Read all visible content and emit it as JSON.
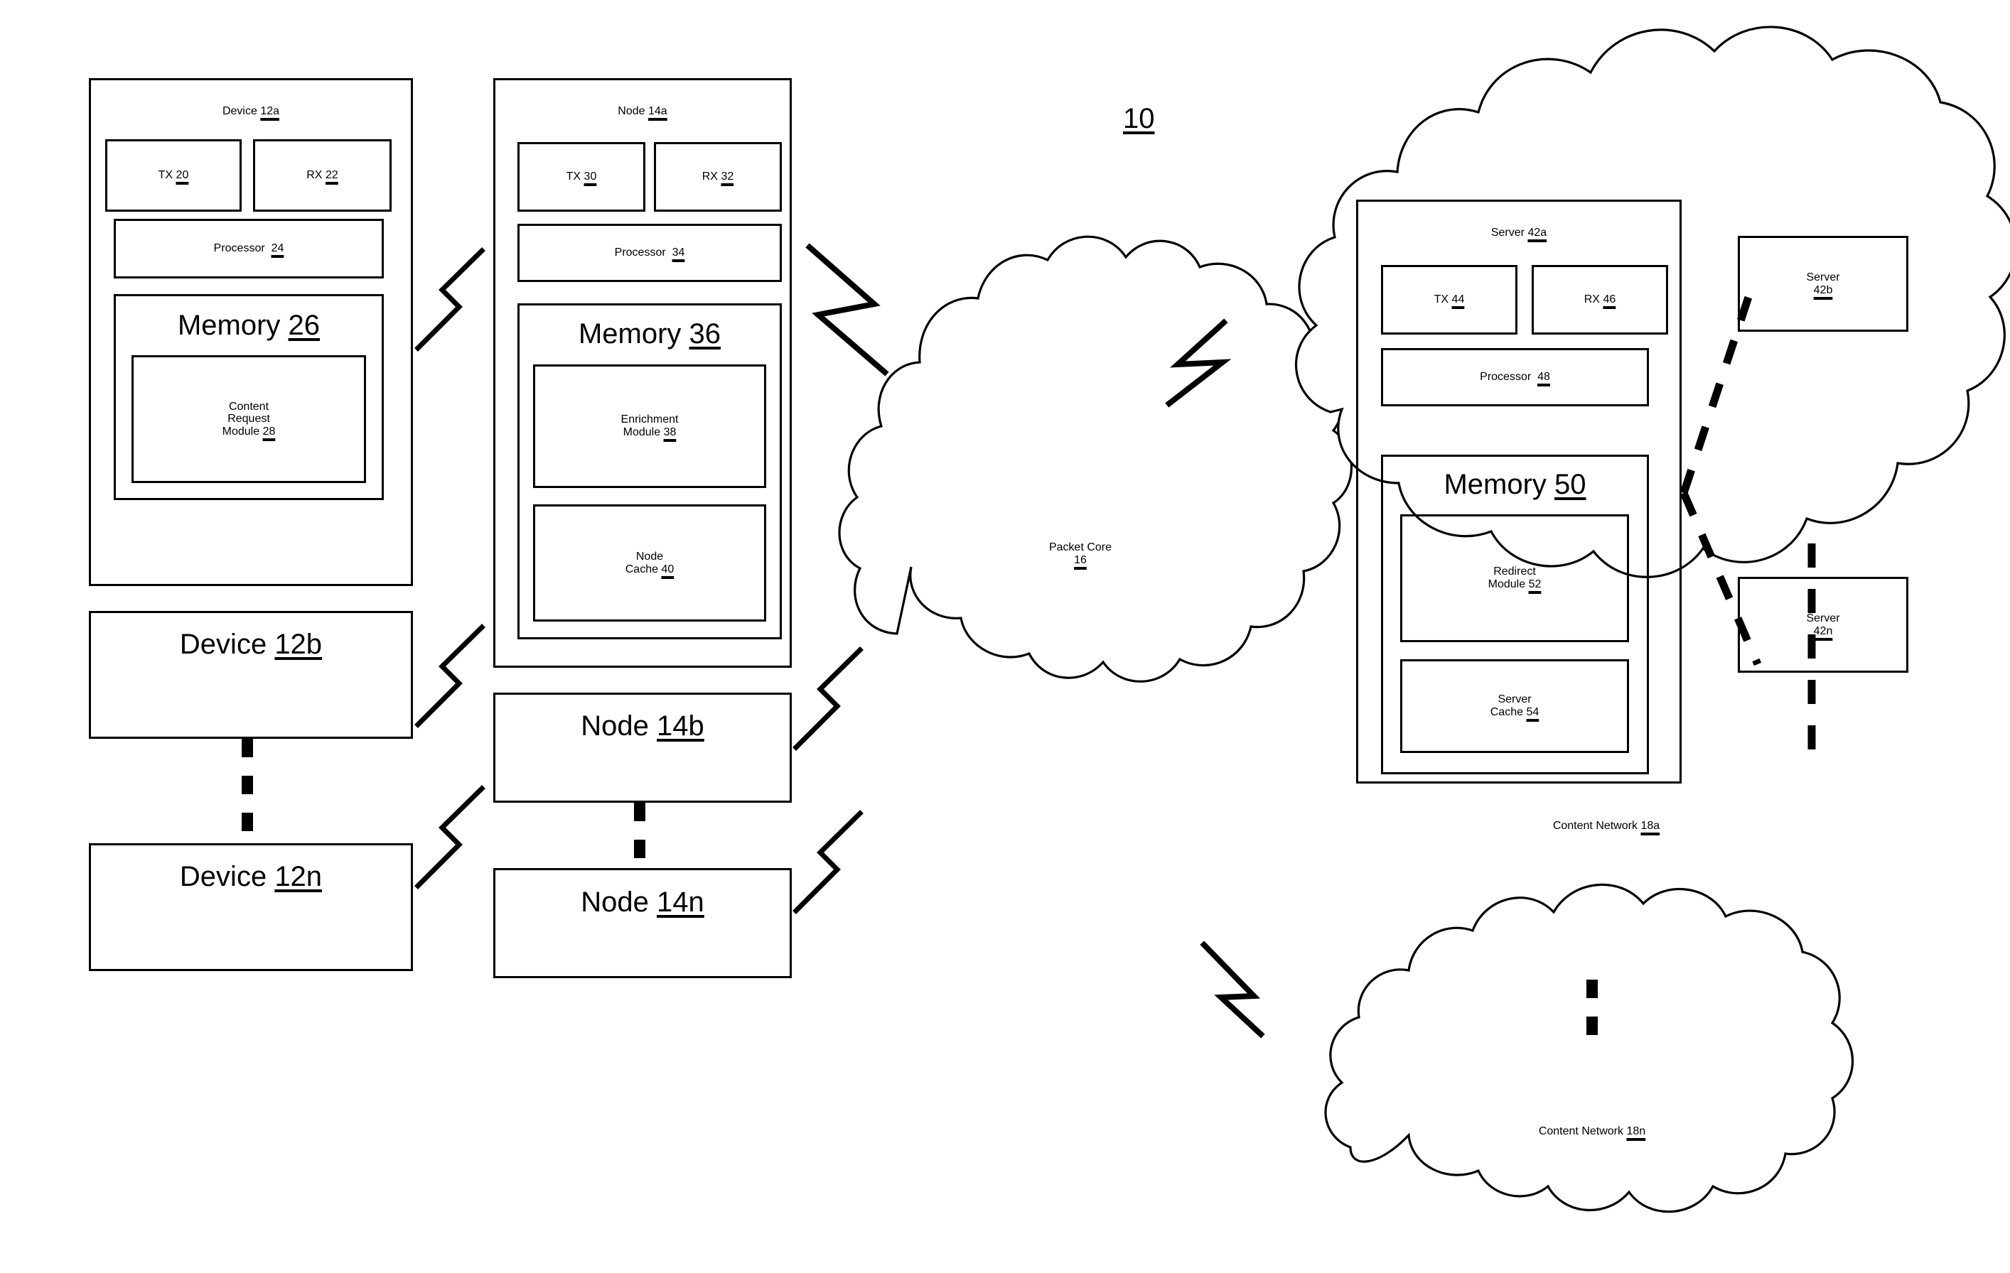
{
  "figure": {
    "reference_numeral": "10"
  },
  "devices": {
    "device_12a": {
      "title": "Device",
      "numeral": "12a",
      "tx": {
        "label": "TX",
        "numeral": "20"
      },
      "rx": {
        "label": "RX",
        "numeral": "22"
      },
      "processor": {
        "label": "Processor",
        "numeral": "24"
      },
      "memory": {
        "label": "Memory",
        "numeral": "26"
      },
      "module": {
        "line1": "Content",
        "line2": "Request",
        "line3": "Module",
        "numeral": "28"
      }
    },
    "device_12b": {
      "title": "Device",
      "numeral": "12b"
    },
    "device_12n": {
      "title": "Device",
      "numeral": "12n"
    }
  },
  "nodes": {
    "node_14a": {
      "title": "Node",
      "numeral": "14a",
      "tx": {
        "label": "TX",
        "numeral": "30"
      },
      "rx": {
        "label": "RX",
        "numeral": "32"
      },
      "processor": {
        "label": "Processor",
        "numeral": "34"
      },
      "memory": {
        "label": "Memory",
        "numeral": "36"
      },
      "enrichment_module": {
        "line1": "Enrichment",
        "line2": "Module",
        "numeral": "38"
      },
      "node_cache": {
        "line1": "Node",
        "line2": "Cache",
        "numeral": "40"
      }
    },
    "node_14b": {
      "title": "Node",
      "numeral": "14b"
    },
    "node_14n": {
      "title": "Node",
      "numeral": "14n"
    }
  },
  "packet_core": {
    "title": "Packet Core",
    "numeral": "16"
  },
  "content_network_18a": {
    "title": "Content Network",
    "numeral": "18a",
    "server_42a": {
      "title": "Server",
      "numeral": "42a",
      "tx": {
        "label": "TX",
        "numeral": "44"
      },
      "rx": {
        "label": "RX",
        "numeral": "46"
      },
      "processor": {
        "label": "Processor",
        "numeral": "48"
      },
      "memory": {
        "label": "Memory",
        "numeral": "50"
      },
      "redirect_module": {
        "line1": "Redirect",
        "line2": "Module",
        "numeral": "52"
      },
      "server_cache": {
        "line1": "Server",
        "line2": "Cache",
        "numeral": "54"
      }
    },
    "server_42b": {
      "line1": "Server",
      "numeral": "42b"
    },
    "server_42n": {
      "line1": "Server",
      "numeral": "42n"
    }
  },
  "content_network_18n": {
    "title": "Content Network",
    "numeral": "18n"
  },
  "colors": {
    "stroke": "#000000",
    "background": "#ffffff"
  }
}
